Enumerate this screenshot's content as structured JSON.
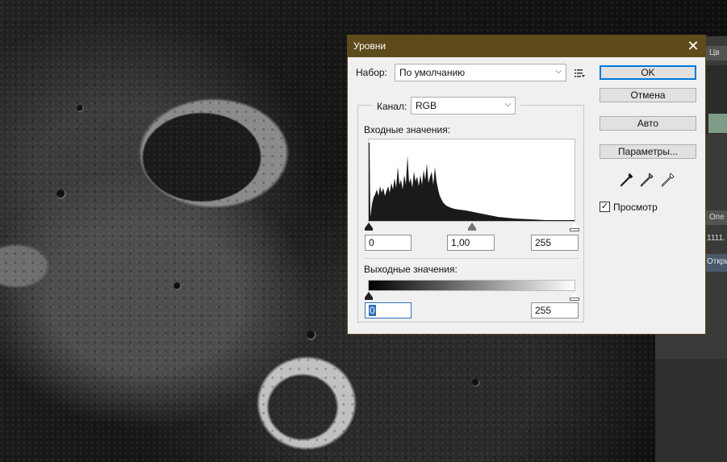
{
  "dialog": {
    "title": "Уровни",
    "close_glyph": "✕",
    "preset_label": "Набор:",
    "preset_value": "По умолчанию",
    "channel_label": "Канал:",
    "channel_value": "RGB",
    "input_label": "Входные значения:",
    "input_levels": {
      "black": "0",
      "gamma": "1,00",
      "white": "255"
    },
    "output_label": "Выходные значения:",
    "output_levels": {
      "black": "0",
      "white": "255"
    },
    "buttons": {
      "ok": "OK",
      "cancel": "Отмена",
      "auto": "Авто",
      "options": "Параметры..."
    },
    "preview_label": "Просмотр",
    "preview_checked": true,
    "check_glyph": "✓",
    "dropdown_glyph": "⌵"
  },
  "right_panel": {
    "tab_top": "Цв",
    "tab_mid": "Опе",
    "file_name": "1111.",
    "open_label": "Откры"
  },
  "colors": {
    "titlebar": "#5e4b1c",
    "default_button_border": "#0078d7",
    "focus": "#2f6fb7"
  },
  "icons": [
    "menu-icon",
    "black-eyedropper-icon",
    "gray-eyedropper-icon",
    "white-eyedropper-icon",
    "close-icon",
    "chevron-down-icon"
  ]
}
